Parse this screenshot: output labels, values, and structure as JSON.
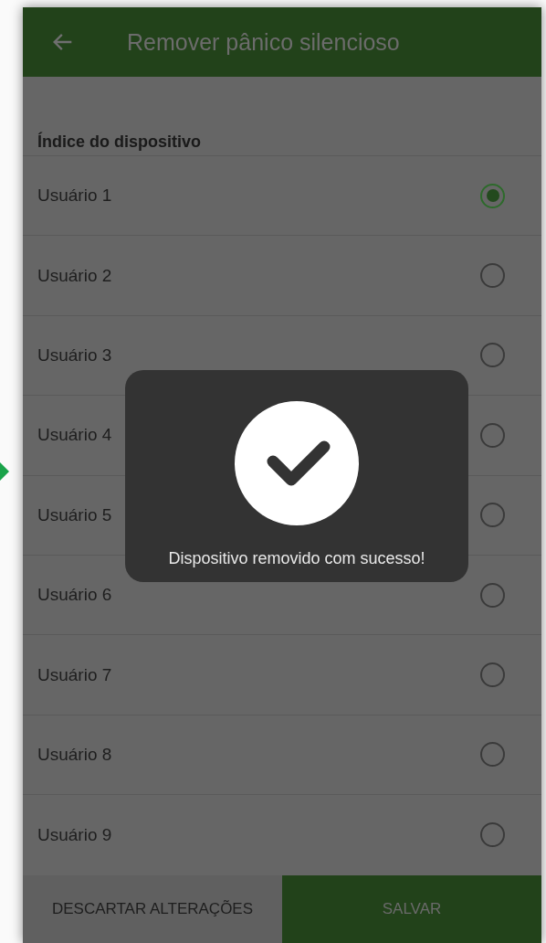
{
  "app_bar": {
    "title": "Remover pânico silencioso"
  },
  "section": {
    "heading": "Índice do dispositivo"
  },
  "options": [
    {
      "label": "Usuário 1",
      "selected": true
    },
    {
      "label": "Usuário 2",
      "selected": false
    },
    {
      "label": "Usuário 3",
      "selected": false
    },
    {
      "label": "Usuário 4",
      "selected": false
    },
    {
      "label": "Usuário 5",
      "selected": false
    },
    {
      "label": "Usuário 6",
      "selected": false
    },
    {
      "label": "Usuário 7",
      "selected": false
    },
    {
      "label": "Usuário 8",
      "selected": false
    },
    {
      "label": "Usuário 9",
      "selected": false
    }
  ],
  "buttons": {
    "discard": "DESCARTAR ALTERAÇÕES",
    "save": "SALVAR"
  },
  "toast": {
    "message": "Dispositivo removido com sucesso!"
  }
}
